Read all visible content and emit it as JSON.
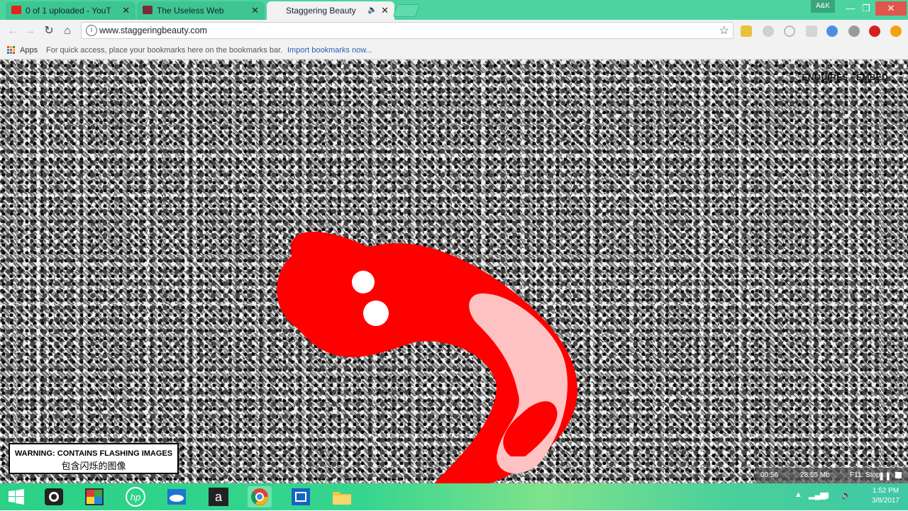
{
  "browser": {
    "tabs": [
      {
        "title": "0 of 1 uploaded - YouTu",
        "close": "✕"
      },
      {
        "title": "The Useless Web",
        "close": "✕"
      },
      {
        "title": "Staggering Beauty",
        "audio": "🔈",
        "close": "✕"
      }
    ],
    "profile": "A&K",
    "window_controls": {
      "minimize": "—",
      "maximize": "❐",
      "close": "✕"
    },
    "nav": {
      "back": "←",
      "forward": "→",
      "reload": "↻",
      "home": "⌂"
    },
    "url": "www.staggeringbeauty.com",
    "info_glyph": "i",
    "bookmark_star": "☆",
    "bookmarks": {
      "apps": "Apps",
      "hint": "For quick access, place your bookmarks here on the bookmarks bar.",
      "import": "Import bookmarks now..."
    }
  },
  "page": {
    "top_links": "ENQUIRES · EMBED",
    "warning_en": "WARNING: CONTAINS FLASHING IMAGES",
    "warning_zh": "包含闪烁的图像"
  },
  "recorder": {
    "time": "00:56",
    "size": "28.55 Mb",
    "stop": "F11: Stop"
  },
  "taskbar": {
    "clock_time": "1:52 PM",
    "clock_date": "3/8/2017"
  },
  "colors": {
    "titlebar": "#4cd3a0",
    "worm_red": "#ff0000",
    "worm_pink": "#ffc2c2"
  }
}
